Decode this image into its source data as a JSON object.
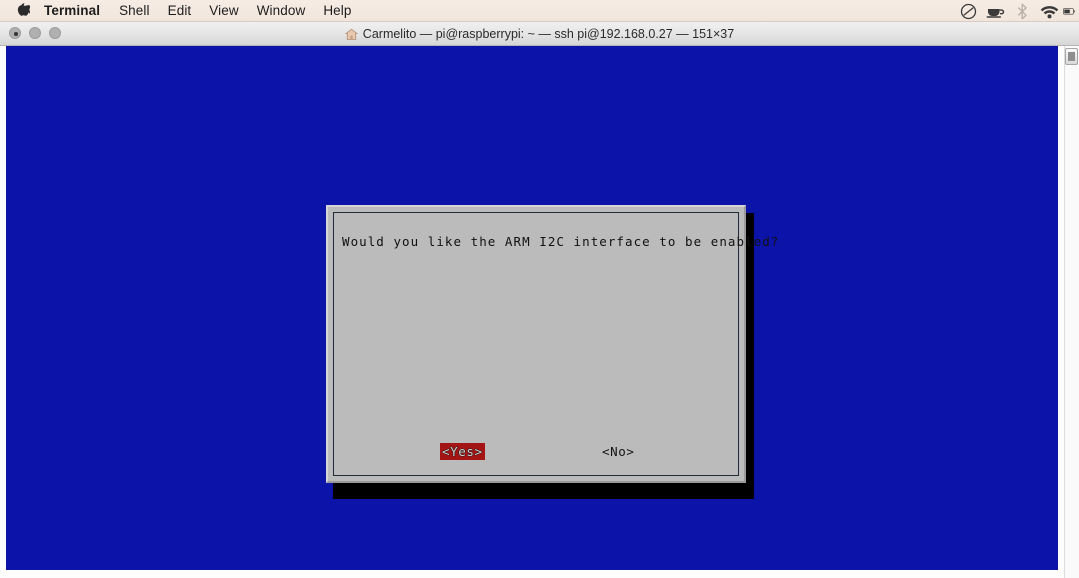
{
  "menubar": {
    "apple_icon": "apple-logo",
    "items": [
      {
        "label": "Terminal",
        "bold": true
      },
      {
        "label": "Shell",
        "bold": false
      },
      {
        "label": "Edit",
        "bold": false
      },
      {
        "label": "View",
        "bold": false
      },
      {
        "label": "Window",
        "bold": false
      },
      {
        "label": "Help",
        "bold": false
      }
    ],
    "status_icons": [
      {
        "name": "do-not-disturb-icon"
      },
      {
        "name": "coffee-cup-icon"
      },
      {
        "name": "bluetooth-icon"
      },
      {
        "name": "wifi-icon"
      },
      {
        "name": "battery-icon"
      }
    ]
  },
  "window": {
    "title": "Carmelito — pi@raspberrypi: ~ — ssh pi@192.168.0.27 — 151×37",
    "title_icon": "home-icon",
    "traffic_lights": [
      {
        "name": "close-button"
      },
      {
        "name": "minimize-button"
      },
      {
        "name": "zoom-button"
      }
    ]
  },
  "terminal": {
    "background_color": "#0c13a8",
    "dialog": {
      "background_color": "#bbbbbb",
      "message": "Would you like the ARM I2C interface to be enabled?",
      "buttons": [
        {
          "label": "<Yes>",
          "selected": true,
          "highlight_color": "#a51414"
        },
        {
          "label": "<No>",
          "selected": false
        }
      ]
    }
  },
  "scrollbar": {
    "name": "terminal-scrollbar"
  }
}
